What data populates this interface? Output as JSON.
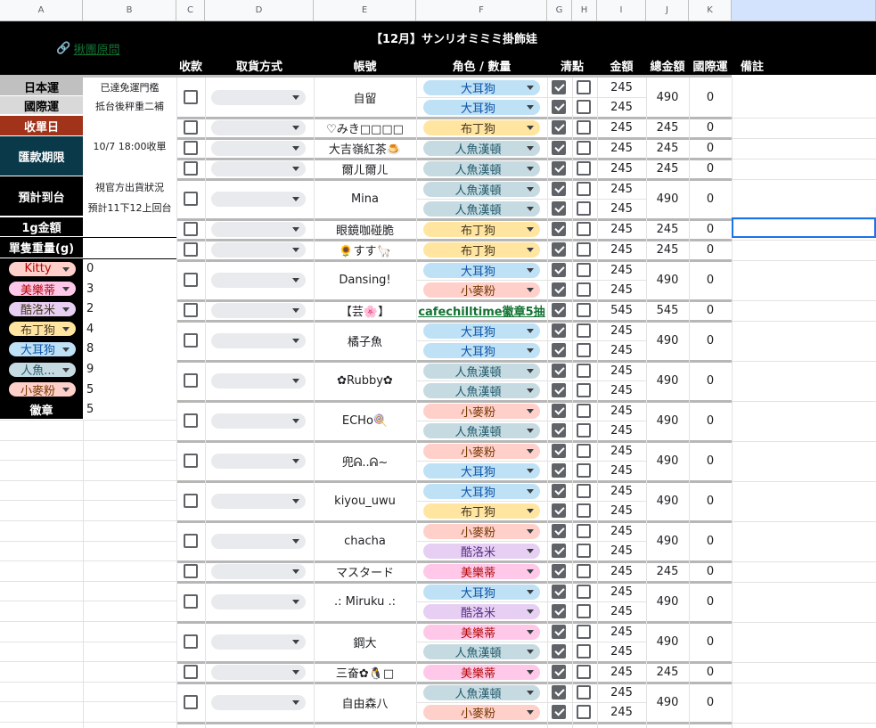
{
  "columns": [
    "A",
    "B",
    "C",
    "D",
    "E",
    "F",
    "G",
    "H",
    "I",
    "J",
    "K",
    ""
  ],
  "title": "【12月】サンリオミミミ掛飾娃",
  "link_text": "揪團原問",
  "headers": {
    "pay": "收款",
    "pickup": "取貨方式",
    "account": "帳號",
    "role": "角色 / 數量",
    "check": "清點",
    "amount": "金額",
    "total": "總金額",
    "intl": "國際運",
    "note": "備註"
  },
  "left_labels": [
    {
      "label": "日本運",
      "value": "已達免運門檻"
    },
    {
      "label": "國際運",
      "value": "抵台後秤重二補"
    },
    {
      "label": "收單日",
      "value": ""
    },
    {
      "label": "匯款期限",
      "value": "10/7 18:00收單"
    },
    {
      "label": "預計到台",
      "value": "視官方出貨狀況"
    },
    {
      "label": "",
      "value": "預計11下12上回台"
    },
    {
      "label": "1g金額",
      "value": ""
    },
    {
      "label": "單隻重量(g)",
      "value": ""
    },
    {
      "label": "徽章",
      "value": "5"
    }
  ],
  "weights": [
    {
      "name": "Kitty",
      "value": "0"
    },
    {
      "name": "美樂蒂",
      "value": "3"
    },
    {
      "name": "酷洛米",
      "value": "2"
    },
    {
      "name": "布丁狗",
      "value": "4"
    },
    {
      "name": "大耳狗",
      "value": "8"
    },
    {
      "name": "人魚...",
      "value": "9"
    },
    {
      "name": "小麥粉",
      "value": "5"
    }
  ],
  "colors": {
    "大耳狗": "#bfe1f6",
    "布丁狗": "#ffe5a0",
    "人魚漢頓": "#c6dbe1",
    "小麥粉": "#ffcfc9",
    "酷洛米": "#e6cff2",
    "美樂蒂": "#ffc8e8",
    "Kitty": "#ffcfc9",
    "recv_date": "#a0331a",
    "deadline": "#0a394a",
    "jp_ship": "#c0c0c0",
    "intl_ship": "#d9d9d9"
  },
  "rows": [
    {
      "account": "自留",
      "total": "490",
      "intl": "0",
      "items": [
        {
          "role": "大耳狗",
          "amount": "245",
          "checked": true
        },
        {
          "role": "大耳狗",
          "amount": "245",
          "checked": true
        }
      ]
    },
    {
      "account": "♡みき□□□□",
      "total": "245",
      "intl": "0",
      "items": [
        {
          "role": "布丁狗",
          "amount": "245",
          "checked": true
        }
      ]
    },
    {
      "account": "大吉嶺紅茶🍮",
      "total": "245",
      "intl": "0",
      "items": [
        {
          "role": "人魚漢頓",
          "amount": "245",
          "checked": true
        }
      ]
    },
    {
      "account": "爾ㄦ爾ㄦ",
      "total": "245",
      "intl": "0",
      "items": [
        {
          "role": "人魚漢頓",
          "amount": "245",
          "checked": true
        }
      ]
    },
    {
      "account": "Mina",
      "total": "490",
      "intl": "0",
      "items": [
        {
          "role": "人魚漢頓",
          "amount": "245",
          "checked": true
        },
        {
          "role": "人魚漢頓",
          "amount": "245",
          "checked": true
        }
      ]
    },
    {
      "account": "眼鏡咖碰脆",
      "total": "245",
      "intl": "0",
      "items": [
        {
          "role": "布丁狗",
          "amount": "245",
          "checked": true
        }
      ]
    },
    {
      "account": "🌻すす🦙",
      "total": "245",
      "intl": "0",
      "items": [
        {
          "role": "布丁狗",
          "amount": "245",
          "checked": true
        }
      ]
    },
    {
      "account": "Dansing!",
      "total": "490",
      "intl": "0",
      "items": [
        {
          "role": "大耳狗",
          "amount": "245",
          "checked": true
        },
        {
          "role": "小麥粉",
          "amount": "245",
          "checked": true
        }
      ]
    },
    {
      "account": "【芸🌸】",
      "total": "545",
      "intl": "0",
      "items": [
        {
          "role": "cafechilltime徽章5抽",
          "amount": "545",
          "checked": true,
          "link": true
        }
      ]
    },
    {
      "account": "橘子魚",
      "total": "490",
      "intl": "0",
      "items": [
        {
          "role": "大耳狗",
          "amount": "245",
          "checked": true
        },
        {
          "role": "大耳狗",
          "amount": "245",
          "checked": true
        }
      ]
    },
    {
      "account": "✿Rubby✿",
      "total": "490",
      "intl": "0",
      "items": [
        {
          "role": "人魚漢頓",
          "amount": "245",
          "checked": true
        },
        {
          "role": "人魚漢頓",
          "amount": "245",
          "checked": true
        }
      ]
    },
    {
      "account": "ECHo🍭",
      "total": "490",
      "intl": "0",
      "items": [
        {
          "role": "小麥粉",
          "amount": "245",
          "checked": true
        },
        {
          "role": "人魚漢頓",
          "amount": "245",
          "checked": true
        }
      ]
    },
    {
      "account": "兜ᕱ..ᕱ~",
      "total": "490",
      "intl": "0",
      "items": [
        {
          "role": "小麥粉",
          "amount": "245",
          "checked": true
        },
        {
          "role": "大耳狗",
          "amount": "245",
          "checked": true
        }
      ]
    },
    {
      "account": "kiyou_uwu",
      "total": "490",
      "intl": "0",
      "items": [
        {
          "role": "大耳狗",
          "amount": "245",
          "checked": true
        },
        {
          "role": "布丁狗",
          "amount": "245",
          "checked": true
        }
      ]
    },
    {
      "account": "chacha",
      "total": "490",
      "intl": "0",
      "items": [
        {
          "role": "小麥粉",
          "amount": "245",
          "checked": true
        },
        {
          "role": "酷洛米",
          "amount": "245",
          "checked": true
        }
      ]
    },
    {
      "account": "マスタード",
      "total": "245",
      "intl": "0",
      "items": [
        {
          "role": "美樂蒂",
          "amount": "245",
          "checked": true
        }
      ]
    },
    {
      "account": ".: Miruku .:",
      "total": "490",
      "intl": "0",
      "items": [
        {
          "role": "大耳狗",
          "amount": "245",
          "checked": true
        },
        {
          "role": "酷洛米",
          "amount": "245",
          "checked": true
        }
      ]
    },
    {
      "account": "鋼大",
      "total": "490",
      "intl": "0",
      "items": [
        {
          "role": "美樂蒂",
          "amount": "245",
          "checked": true
        },
        {
          "role": "人魚漢頓",
          "amount": "245",
          "checked": true
        }
      ]
    },
    {
      "account": "三奋✿🐧□",
      "total": "245",
      "intl": "0",
      "items": [
        {
          "role": "美樂蒂",
          "amount": "245",
          "checked": true
        }
      ]
    },
    {
      "account": "自由森八",
      "total": "490",
      "intl": "0",
      "items": [
        {
          "role": "人魚漢頓",
          "amount": "245",
          "checked": true
        },
        {
          "role": "小麥粉",
          "amount": "245",
          "checked": true
        }
      ]
    }
  ]
}
